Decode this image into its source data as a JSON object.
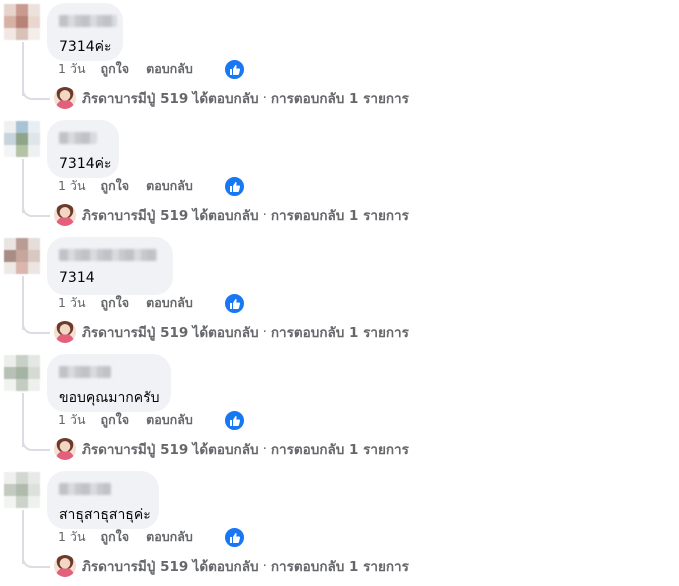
{
  "colors": {
    "bubble": "#f0f2f5",
    "meta_text": "#65676b",
    "like_blue": "#1877f2",
    "thread_line": "#dadde1"
  },
  "comments": [
    {
      "text": "7314ค่ะ",
      "name_width": 58
    },
    {
      "text": "7314ค่ะ",
      "name_width": 38
    },
    {
      "text": "7314",
      "name_width": 98
    },
    {
      "text": "ขอบคุณมากครับ",
      "name_width": 52
    },
    {
      "text": "สาธุสาธุสาธุค่ะ",
      "name_width": 52
    }
  ],
  "actions": {
    "time": "1 วัน",
    "like": "ถูกใจ",
    "reply": "ตอบกลับ"
  },
  "reply_summary": {
    "name": "ภิรดาบารมีปู่ 519",
    "verb": "ได้ตอบกลับ",
    "separator": "·",
    "count_text": "การตอบกลับ 1 รายการ"
  },
  "icons": {
    "like": "thumbs-up-icon"
  }
}
